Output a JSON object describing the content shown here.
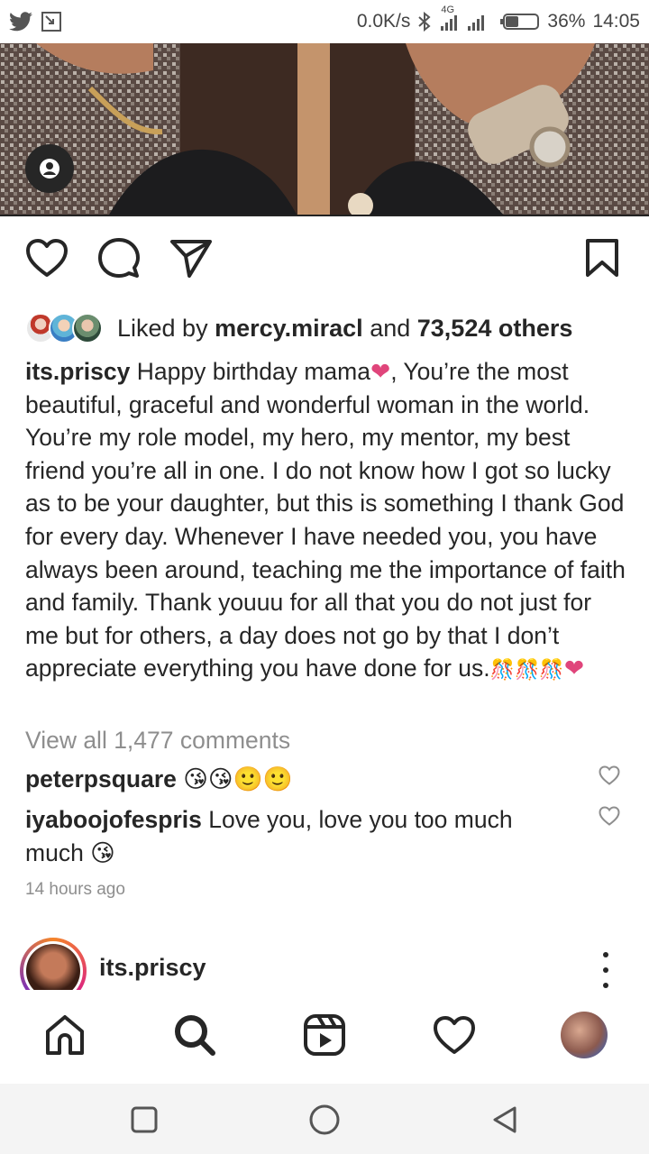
{
  "status_bar": {
    "net_speed": "0.0K/s",
    "network_type": "4G",
    "battery": "36%",
    "time": "14:05",
    "icons": [
      "twitter-icon",
      "screenshot-icon",
      "bluetooth-icon",
      "signal-icon",
      "battery-icon"
    ]
  },
  "post": {
    "likes": {
      "prefix": "Liked by ",
      "user": "mercy.miracl",
      "connector": " and ",
      "count": "73,524 others"
    },
    "caption": {
      "username": "its.priscy",
      "text_1": " Happy birthday mama",
      "text_2": ", You’re the most beautiful, graceful and wonderful woman in the world. You’re my role model, my hero, my mentor, my best friend you’re all in one. ",
      "text_3": "I do not know how I got so lucky as to be your daughter, but this is something I thank God for every day. Whenever I have needed you, you have always been around, teaching me the importance of faith and family. Thank youuu for all that you do not just for me but for others, a day does not go by that I don’t appreciate everything you have done for us.",
      "emoji_end": "🎊🎊🎊"
    },
    "view_all_comments": "View all 1,477 comments",
    "comments": [
      {
        "username": "peterpsquare",
        "text": " 😘😘🙂🙂"
      },
      {
        "username": "iyaboojofespris",
        "text": " Love you, love you too much much 😘"
      }
    ],
    "timestamp": "14 hours ago"
  },
  "next_post": {
    "username": "its.priscy"
  },
  "colors": {
    "heart_pink": "#e0457b",
    "muted": "#8e8e8e",
    "text": "#262626"
  }
}
